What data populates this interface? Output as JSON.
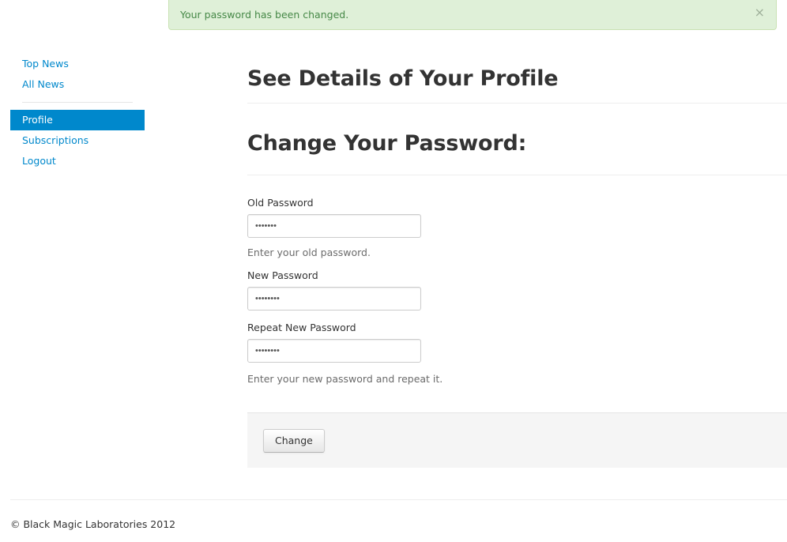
{
  "alert": {
    "message": "Your password has been changed.",
    "close_glyph": "×",
    "type": "success"
  },
  "sidebar": {
    "items": [
      {
        "label": "Top News",
        "active": false
      },
      {
        "label": "All News",
        "active": false
      },
      {
        "label": "Profile",
        "active": true
      },
      {
        "label": "Subscriptions",
        "active": false
      },
      {
        "label": "Logout",
        "active": false
      }
    ]
  },
  "main": {
    "title": "See Details of Your Profile",
    "section_title": "Change Your Password:",
    "fields": {
      "old_password": {
        "label": "Old Password",
        "value": "•••••••",
        "help": "Enter your old password."
      },
      "new_password": {
        "label": "New Password",
        "value": "••••••••"
      },
      "repeat_password": {
        "label": "Repeat New Password",
        "value": "••••••••",
        "help": "Enter your new password and repeat it."
      }
    },
    "submit_label": "Change"
  },
  "footer": {
    "text": "© Black Magic Laboratories 2012"
  },
  "colors": {
    "accent": "#0088cc",
    "success_bg": "#dff0d8",
    "success_text": "#468847"
  }
}
